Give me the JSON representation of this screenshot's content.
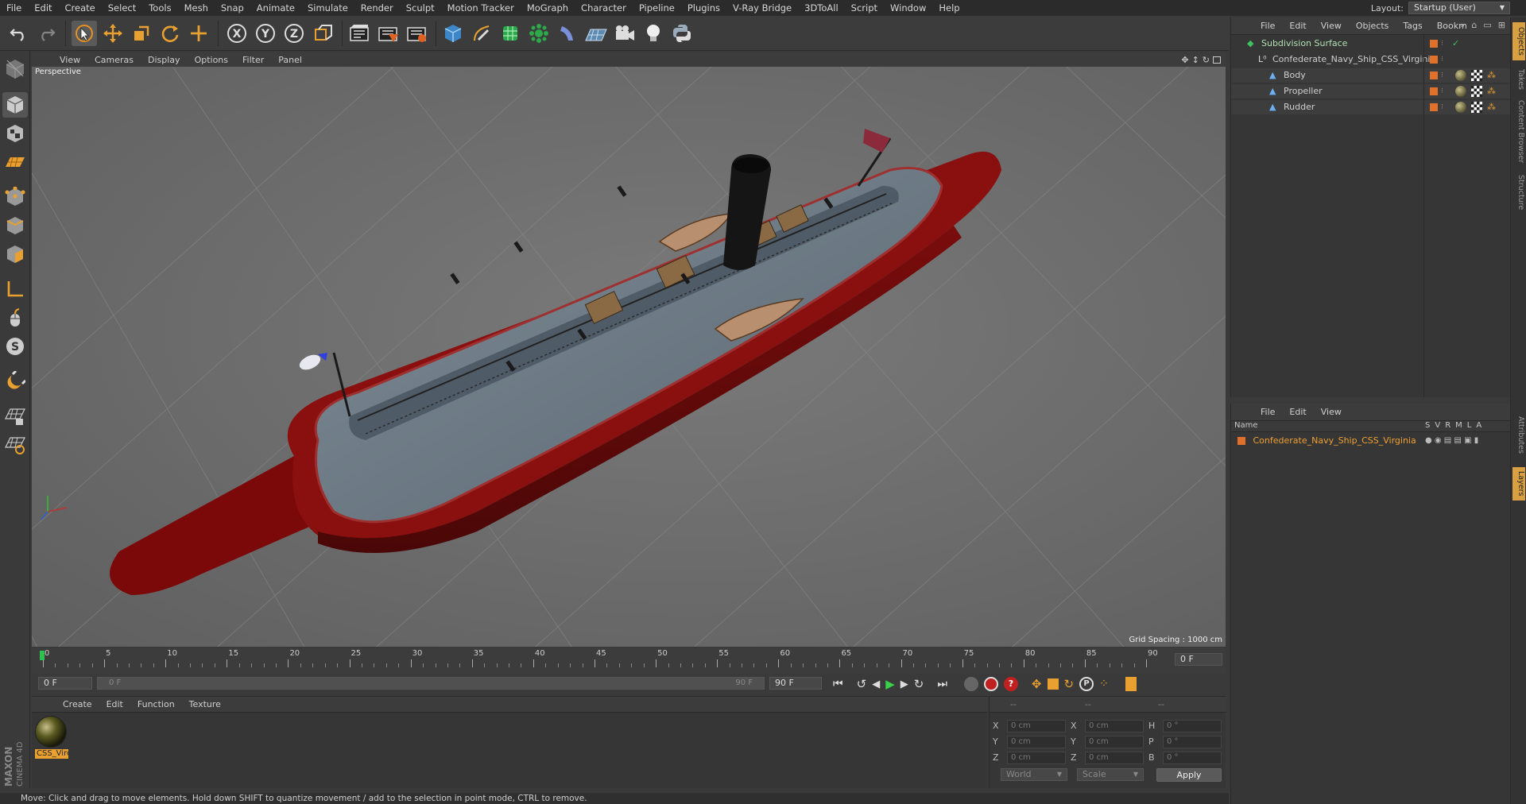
{
  "menubar": {
    "items": [
      "File",
      "Edit",
      "Create",
      "Select",
      "Tools",
      "Mesh",
      "Snap",
      "Animate",
      "Simulate",
      "Render",
      "Sculpt",
      "Motion Tracker",
      "MoGraph",
      "Character",
      "Pipeline",
      "Plugins",
      "V-Ray Bridge",
      "3DToAll",
      "Script",
      "Window",
      "Help"
    ],
    "layout_label": "Layout:",
    "layout_value": "Startup (User)"
  },
  "toolbar": {
    "icons": [
      "undo-icon",
      "redo-icon",
      "live-selection-icon",
      "move-icon",
      "scale-icon",
      "rotate-icon",
      "recent-tools-icon",
      "x-axis-icon",
      "y-axis-icon",
      "z-axis-icon",
      "coordinate-system-icon",
      "render-view-icon",
      "render-picture-viewer-icon",
      "edit-render-settings-icon",
      "cube-icon",
      "pen-spline-icon",
      "subdivision-icon",
      "array-icon",
      "deformer-icon",
      "floor-icon",
      "camera-icon",
      "light-icon",
      "python-icon"
    ],
    "axis_labels": [
      "X",
      "Y",
      "Z"
    ]
  },
  "left_tools": [
    "make-editable-icon",
    "model-mode-icon",
    "texture-mode-icon",
    "workplane-icon",
    "points-mode-icon",
    "edges-mode-icon",
    "polygons-mode-icon",
    "axis-mode-icon",
    "tweak-mode-icon",
    "solo-icon",
    "snap-icon",
    "lock-workplane-icon",
    "workplane-grid-icon"
  ],
  "viewport": {
    "menu": [
      "View",
      "Cameras",
      "Display",
      "Options",
      "Filter",
      "Panel"
    ],
    "camera_label": "Perspective",
    "grid_spacing": "Grid Spacing : 1000 cm"
  },
  "timeline": {
    "ticks": [
      "0",
      "5",
      "10",
      "15",
      "20",
      "25",
      "30",
      "35",
      "40",
      "45",
      "50",
      "55",
      "60",
      "65",
      "70",
      "75",
      "80",
      "85",
      "90"
    ],
    "current_frame": "0 F",
    "start_field": "0 F",
    "range_start": "0 F",
    "range_end": "90 F",
    "end_field": "90 F"
  },
  "material_panel": {
    "menu": [
      "Create",
      "Edit",
      "Function",
      "Texture"
    ],
    "material_name": "CSS_Virc"
  },
  "coordinates": {
    "header": [
      "--",
      "--",
      "--"
    ],
    "rows": [
      {
        "l1": "X",
        "v1": "0 cm",
        "l2": "X",
        "v2": "0 cm",
        "l3": "H",
        "v3": "0 °"
      },
      {
        "l1": "Y",
        "v1": "0 cm",
        "l2": "Y",
        "v2": "0 cm",
        "l3": "P",
        "v3": "0 °"
      },
      {
        "l1": "Z",
        "v1": "0 cm",
        "l2": "Z",
        "v2": "0 cm",
        "l3": "B",
        "v3": "0 °"
      }
    ],
    "world_select": "World",
    "scale_select": "Scale",
    "apply_label": "Apply"
  },
  "object_manager": {
    "menu": [
      "File",
      "Edit",
      "View",
      "Objects",
      "Tags",
      "Bookm"
    ],
    "objects": [
      {
        "name": "Subdivision Surface",
        "indent": 0
      },
      {
        "name": "Confederate_Navy_Ship_CSS_Virginia",
        "indent": 1
      },
      {
        "name": "Body",
        "indent": 2
      },
      {
        "name": "Propeller",
        "indent": 2
      },
      {
        "name": "Rudder",
        "indent": 2
      }
    ]
  },
  "layer_manager": {
    "menu": [
      "File",
      "Edit",
      "View"
    ],
    "columns": {
      "name": "Name",
      "flags": [
        "S",
        "V",
        "R",
        "M",
        "L",
        "A"
      ]
    },
    "layers": [
      {
        "name": "Confederate_Navy_Ship_CSS_Virginia",
        "color": "#e0702a"
      }
    ]
  },
  "right_tabs": [
    "Objects",
    "Takes",
    "Content Browser",
    "Structure",
    "Attributes",
    "Layers"
  ],
  "status": "Move: Click and drag to move elements. Hold down SHIFT to quantize movement / add to the selection in point mode, CTRL to remove.",
  "branding": {
    "line1": "MAXON",
    "line2": "CINEMA 4D"
  },
  "colors": {
    "accent": "#e0702a",
    "selected_text": "#f0a030",
    "hull_red": "#8a1010",
    "deck": "#6e7d88"
  }
}
